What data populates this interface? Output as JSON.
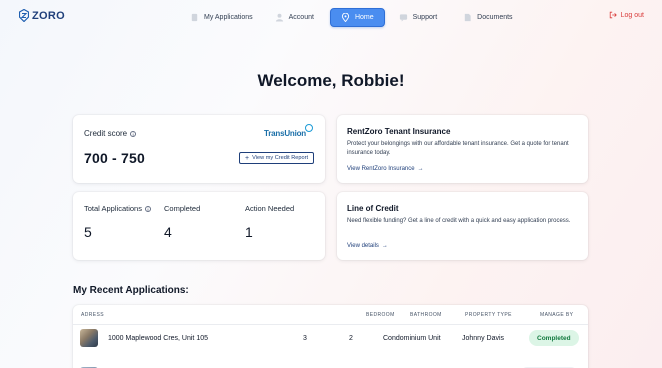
{
  "brand": {
    "name": "ZORO"
  },
  "nav": {
    "items": [
      {
        "label": "My Applications",
        "icon": "document-icon"
      },
      {
        "label": "Account",
        "icon": "user-icon"
      },
      {
        "label": "Home",
        "icon": "location-pin-icon",
        "active": true
      },
      {
        "label": "Support",
        "icon": "chat-icon"
      },
      {
        "label": "Documents",
        "icon": "file-icon"
      }
    ],
    "logout": "Log out"
  },
  "welcome": "Welcome, Robbie!",
  "credit": {
    "label": "Credit score",
    "value": "700 - 750",
    "provider": "TransUnion",
    "button": "View my Credit Report"
  },
  "stats": {
    "total_label": "Total Applications",
    "total_value": "5",
    "completed_label": "Completed",
    "completed_value": "4",
    "action_label": "Action Needed",
    "action_value": "1"
  },
  "insurance": {
    "title": "RentZoro Tenant Insurance",
    "desc": "Protect your belongings with our affordable tenant insurance. Get a quote for tenant insurance today.",
    "link": "View RentZoro Insurance"
  },
  "line_of_credit": {
    "title": "Line of Credit",
    "desc": "Need flexible funding? Get a line of credit with a quick and easy application process.",
    "link": "View details"
  },
  "recent": {
    "title": "My Recent Applications:",
    "columns": [
      "ADRESS",
      "BEDROOM",
      "BATHROOM",
      "PROPERTY TYPE",
      "MANAGE BY"
    ],
    "rows": [
      {
        "address": "1000 Maplewood Cres, Unit 105",
        "bedroom": "3",
        "bathroom": "2",
        "type": "Condominium Unit",
        "manager": "Johnny Davis",
        "status": "Completed"
      }
    ]
  },
  "colors": {
    "accent": "#4a8df0",
    "brand": "#1f3f7a",
    "logout": "#d93a3a",
    "status_completed": "#137a3f"
  }
}
